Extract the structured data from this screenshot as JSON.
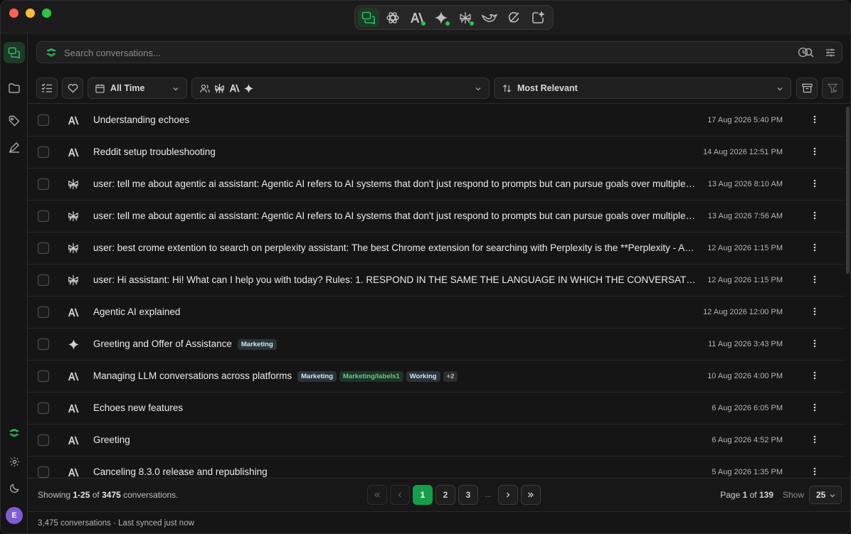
{
  "app_switcher": {
    "items": [
      {
        "name": "echoes-chat-icon",
        "active": true,
        "dot": false
      },
      {
        "name": "chatgpt-icon",
        "active": false,
        "dot": false
      },
      {
        "name": "claude-icon",
        "active": false,
        "dot": true
      },
      {
        "name": "gemini-icon",
        "active": false,
        "dot": true
      },
      {
        "name": "perplexity-icon",
        "active": false,
        "dot": true
      },
      {
        "name": "deepseek-icon",
        "active": false,
        "dot": false
      },
      {
        "name": "grok-icon",
        "active": false,
        "dot": false
      },
      {
        "name": "new-chat-icon",
        "active": false,
        "dot": false
      }
    ]
  },
  "sidebar": {
    "top": [
      "conversations-icon",
      "folder-icon",
      "tag-icon",
      "pen-icon"
    ],
    "bottom": [
      "echoes-logo-icon",
      "gear-icon",
      "moon-icon"
    ],
    "avatar_letter": "E"
  },
  "search": {
    "placeholder": "Search conversations..."
  },
  "filters": {
    "time_label": "All Time",
    "sort_label": "Most Relevant"
  },
  "conversations": [
    {
      "icon": "claude",
      "title": "Understanding echoes",
      "tags": [],
      "date": "17 Aug 2026 5:40 PM"
    },
    {
      "icon": "claude",
      "title": "Reddit setup troubleshooting",
      "tags": [],
      "date": "14 Aug 2026 12:51 PM"
    },
    {
      "icon": "perplexity",
      "title": "user: tell me about agentic ai assistant: Agentic AI refers to AI systems that don't just respond to prompts but can pursue goals over multiple steps, make decisions, and take actions",
      "tags": [],
      "date": "13 Aug 2026 8:10 AM"
    },
    {
      "icon": "perplexity",
      "title": "user: tell me about agentic ai assistant: Agentic AI refers to AI systems that don't just respond to prompts but can pursue goals over multiple steps, make decisions, and take actions",
      "tags": [],
      "date": "13 Aug 2026 7:56 AM"
    },
    {
      "icon": "perplexity",
      "title": "user: best crome extention to search on perplexity assistant: The best Chrome extension for searching with Perplexity is the **Perplexity - AI Search** extension",
      "tags": [],
      "date": "12 Aug 2026 1:15 PM"
    },
    {
      "icon": "perplexity",
      "title": "user: Hi assistant: Hi! What can I help you with today? Rules: 1. RESPOND IN THE SAME THE LANGUAGE IN WHICH THE CONVERSATION SUMMARY IS WRITTEN",
      "tags": [],
      "date": "12 Aug 2026 1:15 PM"
    },
    {
      "icon": "claude",
      "title": "Agentic AI explained",
      "tags": [],
      "date": "12 Aug 2026 12:00 PM"
    },
    {
      "icon": "gemini",
      "title": "Greeting and Offer of Assistance",
      "tags": [
        {
          "text": "Marketing",
          "style": "blue"
        }
      ],
      "date": "11 Aug 2026 3:43 PM"
    },
    {
      "icon": "claude",
      "title": "Managing LLM conversations across platforms",
      "tags": [
        {
          "text": "Marketing",
          "style": "blue"
        },
        {
          "text": "Marketing/labels1",
          "style": "green"
        },
        {
          "text": "Working",
          "style": "blue"
        },
        {
          "text": "+2",
          "style": "more"
        }
      ],
      "date": "10 Aug 2026 4:00 PM"
    },
    {
      "icon": "claude",
      "title": "Echoes new features",
      "tags": [],
      "date": "6 Aug 2026 6:05 PM"
    },
    {
      "icon": "claude",
      "title": "Greeting",
      "tags": [],
      "date": "6 Aug 2026 4:52 PM"
    },
    {
      "icon": "claude",
      "title": "Canceling 8.3.0 release and republishing",
      "tags": [],
      "date": "5 Aug 2026 1:35 PM"
    }
  ],
  "footer": {
    "showing_prefix": "Showing ",
    "showing_range": "1-25",
    "showing_of": " of ",
    "showing_total": "3475",
    "showing_suffix": " conversations.",
    "pages": [
      "1",
      "2",
      "3"
    ],
    "ellipsis": "...",
    "current_page": "1",
    "page_prefix": "Page ",
    "page_of": " of ",
    "page_total": "139",
    "show_label": "Show",
    "page_size": "25"
  },
  "status_bar": {
    "text": "3,475 conversations · Last synced just now"
  },
  "colors": {
    "accent": "#12a04a",
    "accent_dim": "#1d3b28",
    "background": "#151515"
  }
}
